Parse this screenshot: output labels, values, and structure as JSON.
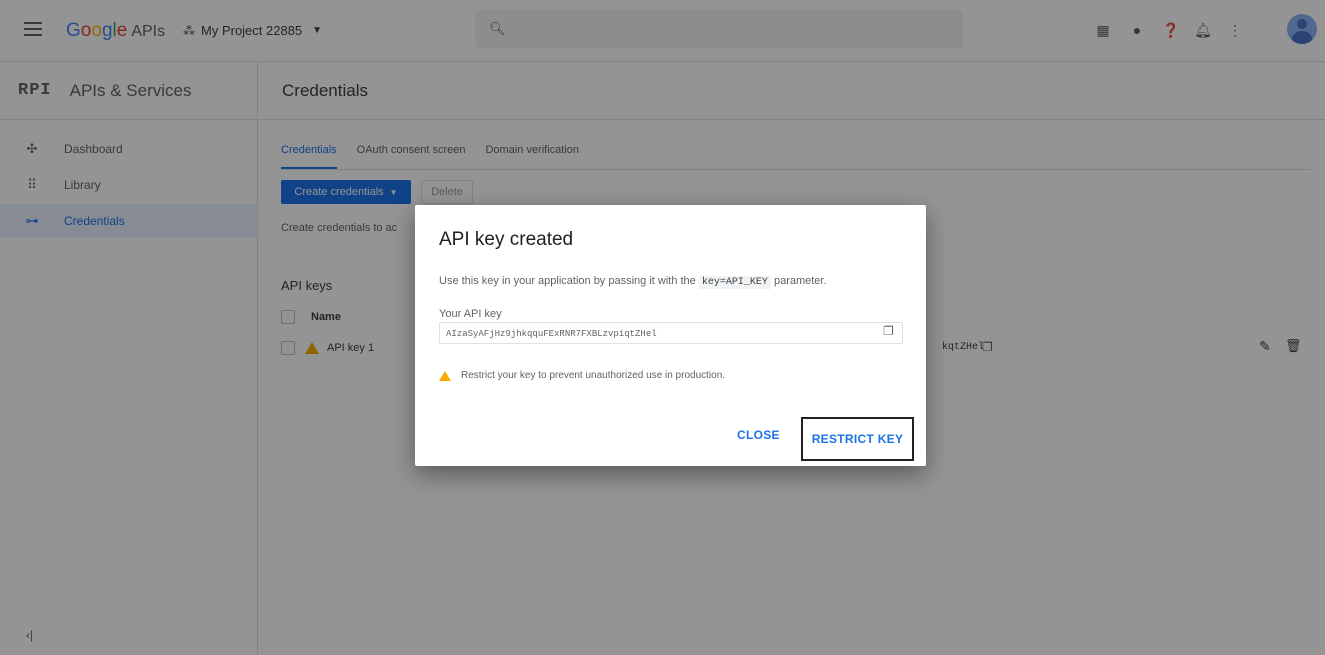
{
  "topbar": {
    "logo": {
      "g1": "G",
      "g2": "o",
      "g3": "o",
      "g4": "g",
      "g5": "l",
      "g6": "e",
      "apis": "APIs"
    },
    "project_name": "My Project 22885",
    "search_placeholder": "",
    "icons": [
      "gift-icon",
      "chat-icon",
      "help-icon",
      "notifications-icon",
      "more-icon",
      "avatar"
    ]
  },
  "sidebar": {
    "badge": "RPI",
    "title": "APIs & Services",
    "items": [
      {
        "icon": "dashboard-icon",
        "glyph": "✣",
        "label": "Dashboard"
      },
      {
        "icon": "library-icon",
        "glyph": "⠿",
        "label": "Library"
      },
      {
        "icon": "key-icon",
        "glyph": "⊶",
        "label": "Credentials"
      }
    ],
    "collapse_glyph": "‹|"
  },
  "main": {
    "title": "Credentials",
    "tabs": [
      "Credentials",
      "OAuth consent screen",
      "Domain verification"
    ],
    "create_button": "Create credentials",
    "delete_button": "Delete",
    "create_hint": "Create credentials to ac",
    "api_keys_title": "API keys",
    "table": {
      "headers": [
        "Name"
      ],
      "rows": [
        {
          "name": "API key 1",
          "key_fragment": "kqtZHel"
        }
      ]
    }
  },
  "dialog": {
    "title": "API key created",
    "desc_prefix": "Use this key in your application by passing it with the",
    "desc_code": "key=API_KEY",
    "desc_suffix": "parameter.",
    "field_label": "Your API key",
    "api_key": "AIzaSyAFjHz9jhkqquFExRNR7FXBLzvpiqtZHel",
    "warning": "Restrict your key to prevent unauthorized use in production.",
    "close_button": "CLOSE",
    "restrict_button": "RESTRICT KEY"
  },
  "colors": {
    "accent": "#1a73e8",
    "warning": "#f9ab00",
    "overlay": "#000000"
  }
}
